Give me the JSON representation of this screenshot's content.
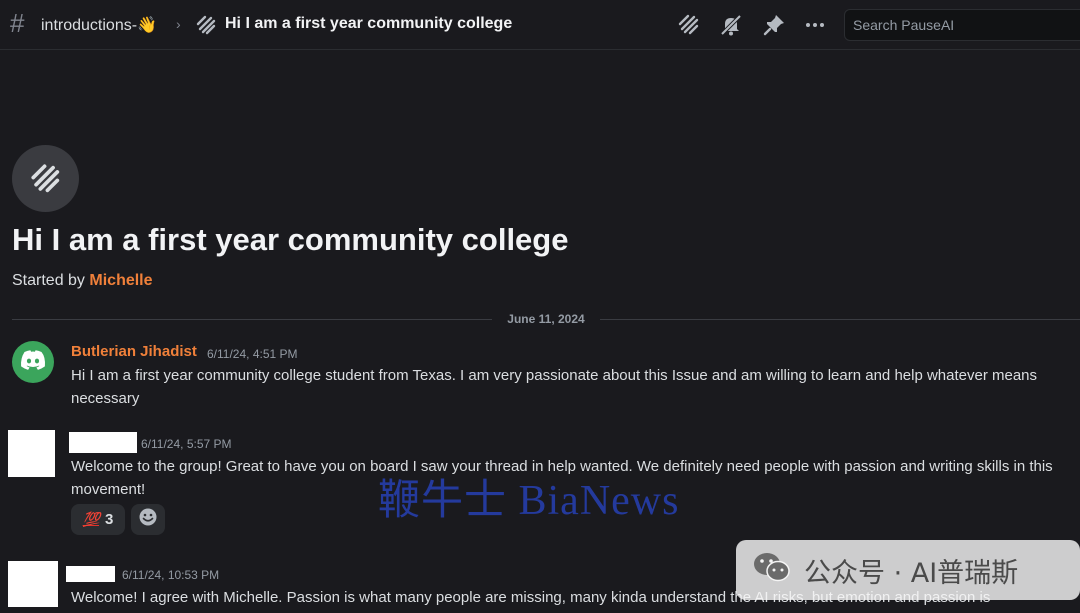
{
  "header": {
    "channel_name": "introductions-👋",
    "thread_title": "Hi I am a first year community college",
    "search_placeholder": "Search PauseAI"
  },
  "thread": {
    "title": "Hi I am a first year community college",
    "started_by_prefix": "Started by",
    "started_by_author": "Michelle"
  },
  "divider": {
    "date": "June 11, 2024"
  },
  "messages": [
    {
      "author": "Butlerian Jihadist",
      "author_color": "#f0803a",
      "timestamp": "6/11/24, 4:51 PM",
      "text": "Hi I am a first year community college student from Texas. I am very passionate about this Issue and am willing to learn and help whatever means necessary"
    },
    {
      "author": "",
      "timestamp": "6/11/24, 5:57 PM",
      "text": "Welcome to the group! Great to have you on board I saw your thread in help wanted. We definitely need people with passion and writing skills in this movement!",
      "reactions": [
        {
          "emoji": "💯",
          "count": "3"
        }
      ]
    },
    {
      "author": "",
      "timestamp": "6/11/24, 10:53 PM",
      "text": "Welcome! I agree with Michelle. Passion is what many people are missing, many kinda understand the AI risks, but emotion and passion is"
    }
  ],
  "watermarks": {
    "bianews": "鞭牛士 BiaNews",
    "wechat": "公众号 · AI普瑞斯"
  },
  "colors": {
    "background": "#1a1a1e",
    "accent_author": "#f0803a",
    "discord_avatar": "#3ba55c"
  },
  "icons": [
    "hash-icon",
    "chevron-right-icon",
    "thread-icon",
    "threads-icon",
    "mute-bell-icon",
    "pin-icon",
    "more-icon",
    "discord-icon",
    "add-reaction-icon",
    "wechat-icon"
  ]
}
